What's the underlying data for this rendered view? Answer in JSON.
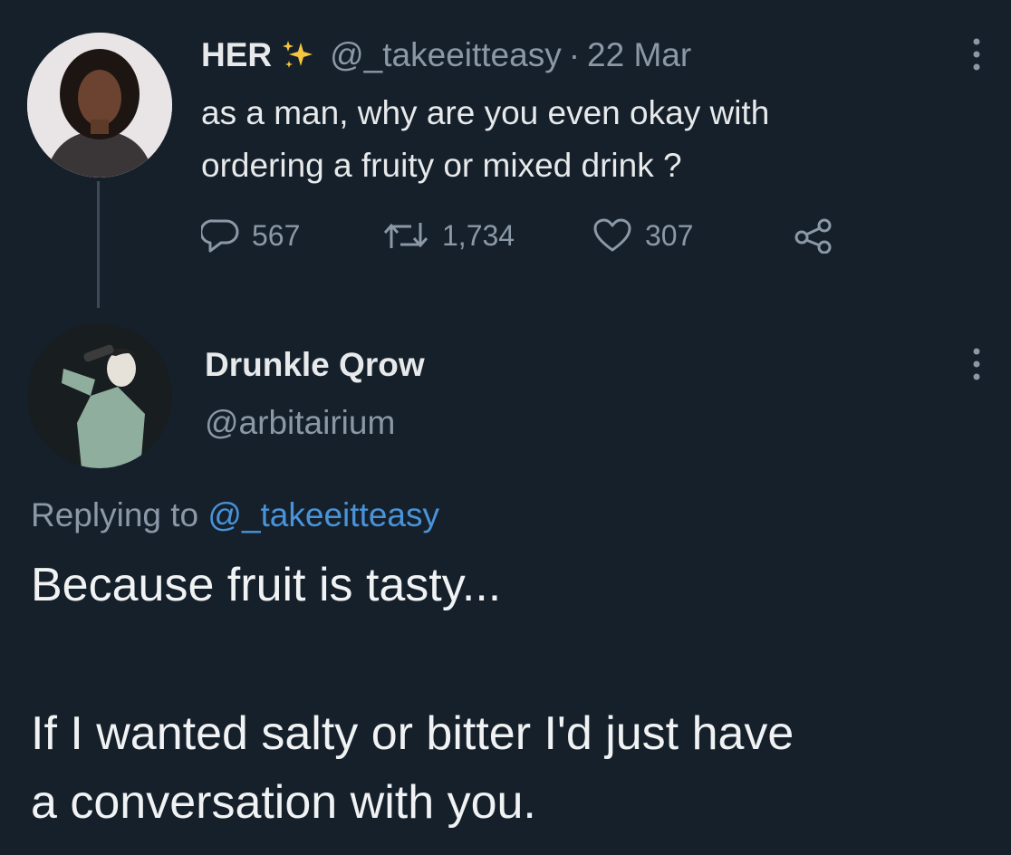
{
  "tweet1": {
    "display_name": "HER",
    "handle": "@_takeeitteasy",
    "separator": "·",
    "date": "22 Mar",
    "text_line1": "as a man, why are you even okay with",
    "text_line2": "ordering a fruity or mixed drink ?",
    "replies": "567",
    "retweets": "1,734",
    "likes": "307",
    "icons": [
      "sparkles-icon",
      "more-icon",
      "reply-icon",
      "retweet-icon",
      "like-icon",
      "share-icon"
    ]
  },
  "tweet2": {
    "display_name": "Drunkle Qrow",
    "handle": "@arbitairium",
    "replying_prefix": "Replying to",
    "replying_handle": "@_takeeitteasy",
    "text_line1": "Because fruit is tasty...",
    "text_line2": "If I wanted salty or bitter I'd just have",
    "text_line3": "a conversation with you."
  },
  "colors": {
    "background": "#15202b",
    "text": "#e7e9ea",
    "muted": "#8b98a5",
    "link": "#4a93d8",
    "sparkle": "#f5c542"
  }
}
